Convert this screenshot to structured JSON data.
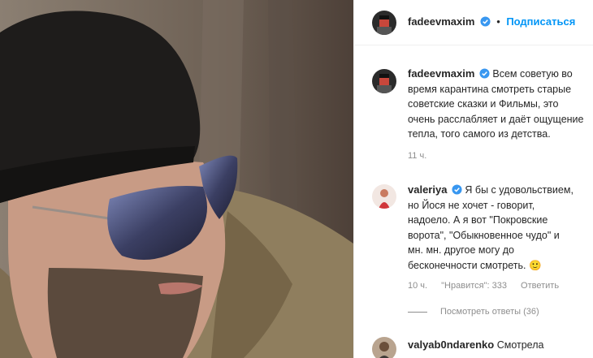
{
  "post": {
    "author": "fadeevmaxim",
    "separator": "•",
    "follow_label": "Подписаться",
    "caption_lines": [
      "Всем советую во",
      "время карантина смотреть старые",
      "советские сказки и Фильмы, это",
      "очень расслабляет и даёт ощущение",
      "тепла, того самого из детства."
    ],
    "caption_time": "11 ч."
  },
  "comments": [
    {
      "author": "valeriya",
      "lines": [
        "Я бы с удовольствием,",
        "но Йося не хочет - говорит,",
        "надоело. А я вот \"Покровские",
        "ворота\", \"Обыкновенное чудо\" и",
        "мн. мн. другое могу до",
        "бесконечности смотреть. 🙂"
      ],
      "time": "10 ч.",
      "likes": "\"Нравится\": 333",
      "reply_label": "Ответить",
      "view_replies": "Посмотреть ответы (36)"
    },
    {
      "author": "valyab0ndarenko",
      "lines": [
        "Смотрела"
      ]
    }
  ],
  "colors": {
    "accent": "#0095f6",
    "muted": "#8e8e8e",
    "verified": "#3897f0"
  },
  "icons": [
    "verified-badge-icon",
    "smile-emoji-icon"
  ]
}
